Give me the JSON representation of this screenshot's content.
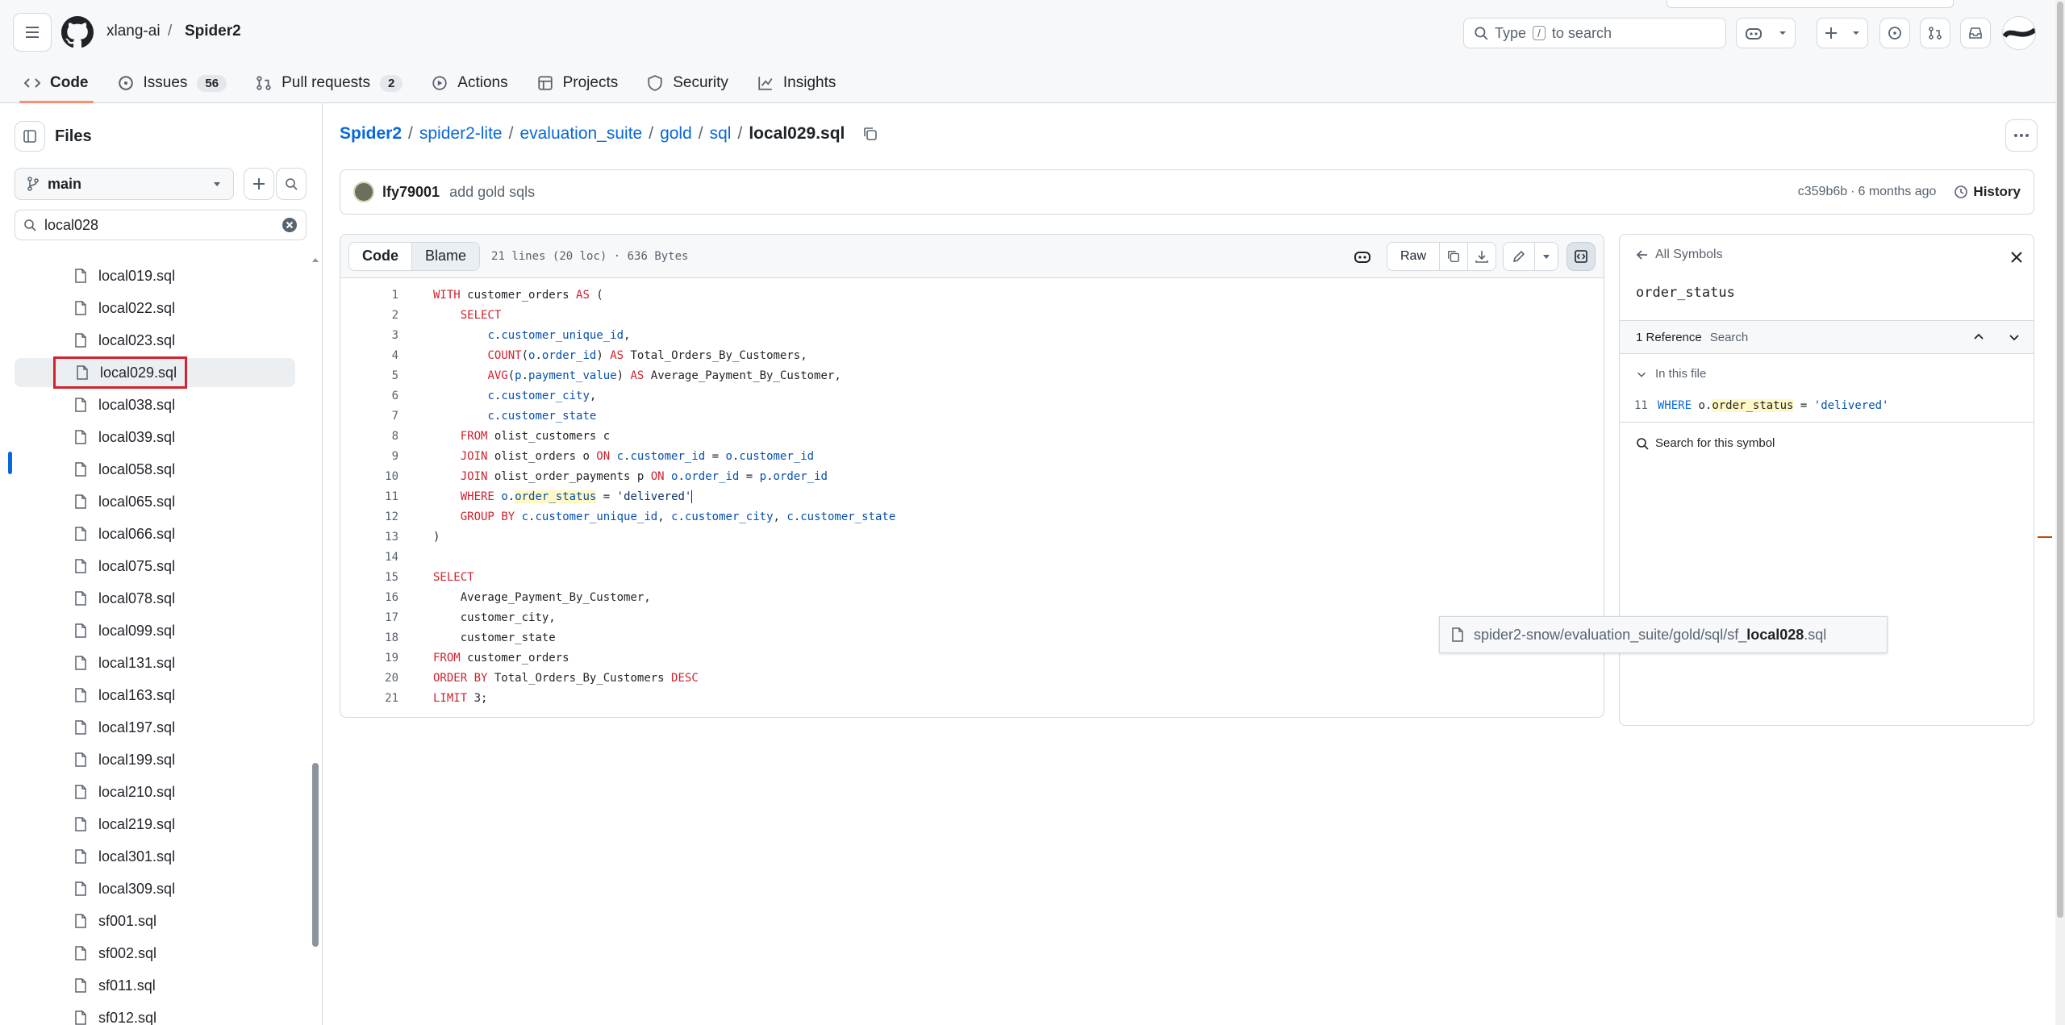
{
  "header": {
    "owner": "xlang-ai",
    "separator": "/",
    "repo": "Spider2",
    "search_prefix": "Type",
    "search_key": "/",
    "search_suffix": "to search"
  },
  "nav": {
    "code": "Code",
    "issues": "Issues",
    "issues_count": "56",
    "pulls": "Pull requests",
    "pulls_count": "2",
    "actions": "Actions",
    "projects": "Projects",
    "security": "Security",
    "insights": "Insights"
  },
  "sidebar": {
    "title": "Files",
    "branch": "main",
    "filter_value": "local028",
    "files": [
      "local019.sql",
      "local022.sql",
      "local023.sql",
      "local029.sql",
      "local038.sql",
      "local039.sql",
      "local058.sql",
      "local065.sql",
      "local066.sql",
      "local075.sql",
      "local078.sql",
      "local099.sql",
      "local131.sql",
      "local163.sql",
      "local197.sql",
      "local199.sql",
      "local210.sql",
      "local219.sql",
      "local301.sql",
      "local309.sql",
      "sf001.sql",
      "sf002.sql",
      "sf011.sql",
      "sf012.sql"
    ],
    "selected_file": "local029.sql"
  },
  "breadcrumb": {
    "parts": [
      "Spider2",
      "spider2-lite",
      "evaluation_suite",
      "gold",
      "sql"
    ],
    "file": "local029.sql"
  },
  "commit": {
    "author": "lfy79001",
    "message": "add gold sqls",
    "sha": "c359b6b",
    "dot": "·",
    "age": "6 months ago",
    "history": "History"
  },
  "code_header": {
    "code_tab": "Code",
    "blame_tab": "Blame",
    "stats": "21 lines (20 loc) · 636 Bytes",
    "raw": "Raw"
  },
  "code_lines": [
    {
      "n": "1",
      "text": "WITH customer_orders AS ("
    },
    {
      "n": "2",
      "text": "    SELECT"
    },
    {
      "n": "3",
      "text": "        c.customer_unique_id,"
    },
    {
      "n": "4",
      "text": "        COUNT(o.order_id) AS Total_Orders_By_Customers,"
    },
    {
      "n": "5",
      "text": "        AVG(p.payment_value) AS Average_Payment_By_Customer,"
    },
    {
      "n": "6",
      "text": "        c.customer_city,"
    },
    {
      "n": "7",
      "text": "        c.customer_state"
    },
    {
      "n": "8",
      "text": "    FROM olist_customers c"
    },
    {
      "n": "9",
      "text": "    JOIN olist_orders o ON c.customer_id = o.customer_id"
    },
    {
      "n": "10",
      "text": "    JOIN olist_order_payments p ON o.order_id = p.order_id"
    },
    {
      "n": "11",
      "text": "    WHERE o.order_status = 'delivered'"
    },
    {
      "n": "12",
      "text": "    GROUP BY c.customer_unique_id, c.customer_city, c.customer_state"
    },
    {
      "n": "13",
      "text": ")"
    },
    {
      "n": "14",
      "text": ""
    },
    {
      "n": "15",
      "text": "SELECT"
    },
    {
      "n": "16",
      "text": "    Average_Payment_By_Customer,"
    },
    {
      "n": "17",
      "text": "    customer_city,"
    },
    {
      "n": "18",
      "text": "    customer_state"
    },
    {
      "n": "19",
      "text": "FROM customer_orders"
    },
    {
      "n": "20",
      "text": "ORDER BY Total_Orders_By_Customers DESC"
    },
    {
      "n": "21",
      "text": "LIMIT 3;"
    }
  ],
  "symbols": {
    "back_label": "All Symbols",
    "symbol": "order_status",
    "ref_count": "1 Reference",
    "search_placeholder": "Search",
    "in_file": "In this file",
    "ref_line": "11",
    "ref_text": "WHERE o.order_status = 'delivered'",
    "search_symbol": "Search for this symbol"
  },
  "tooltip": {
    "path_prefix": "spider2-snow/evaluation_suite/gold/sql/sf_",
    "path_match": "local028",
    "path_suffix": ".sql"
  },
  "colors": {
    "accent": "#0969da",
    "tab_underline": "#fd8c73",
    "selected_border": "#d1242f",
    "keyword": "#cf222e",
    "identifier": "#0550ae"
  }
}
